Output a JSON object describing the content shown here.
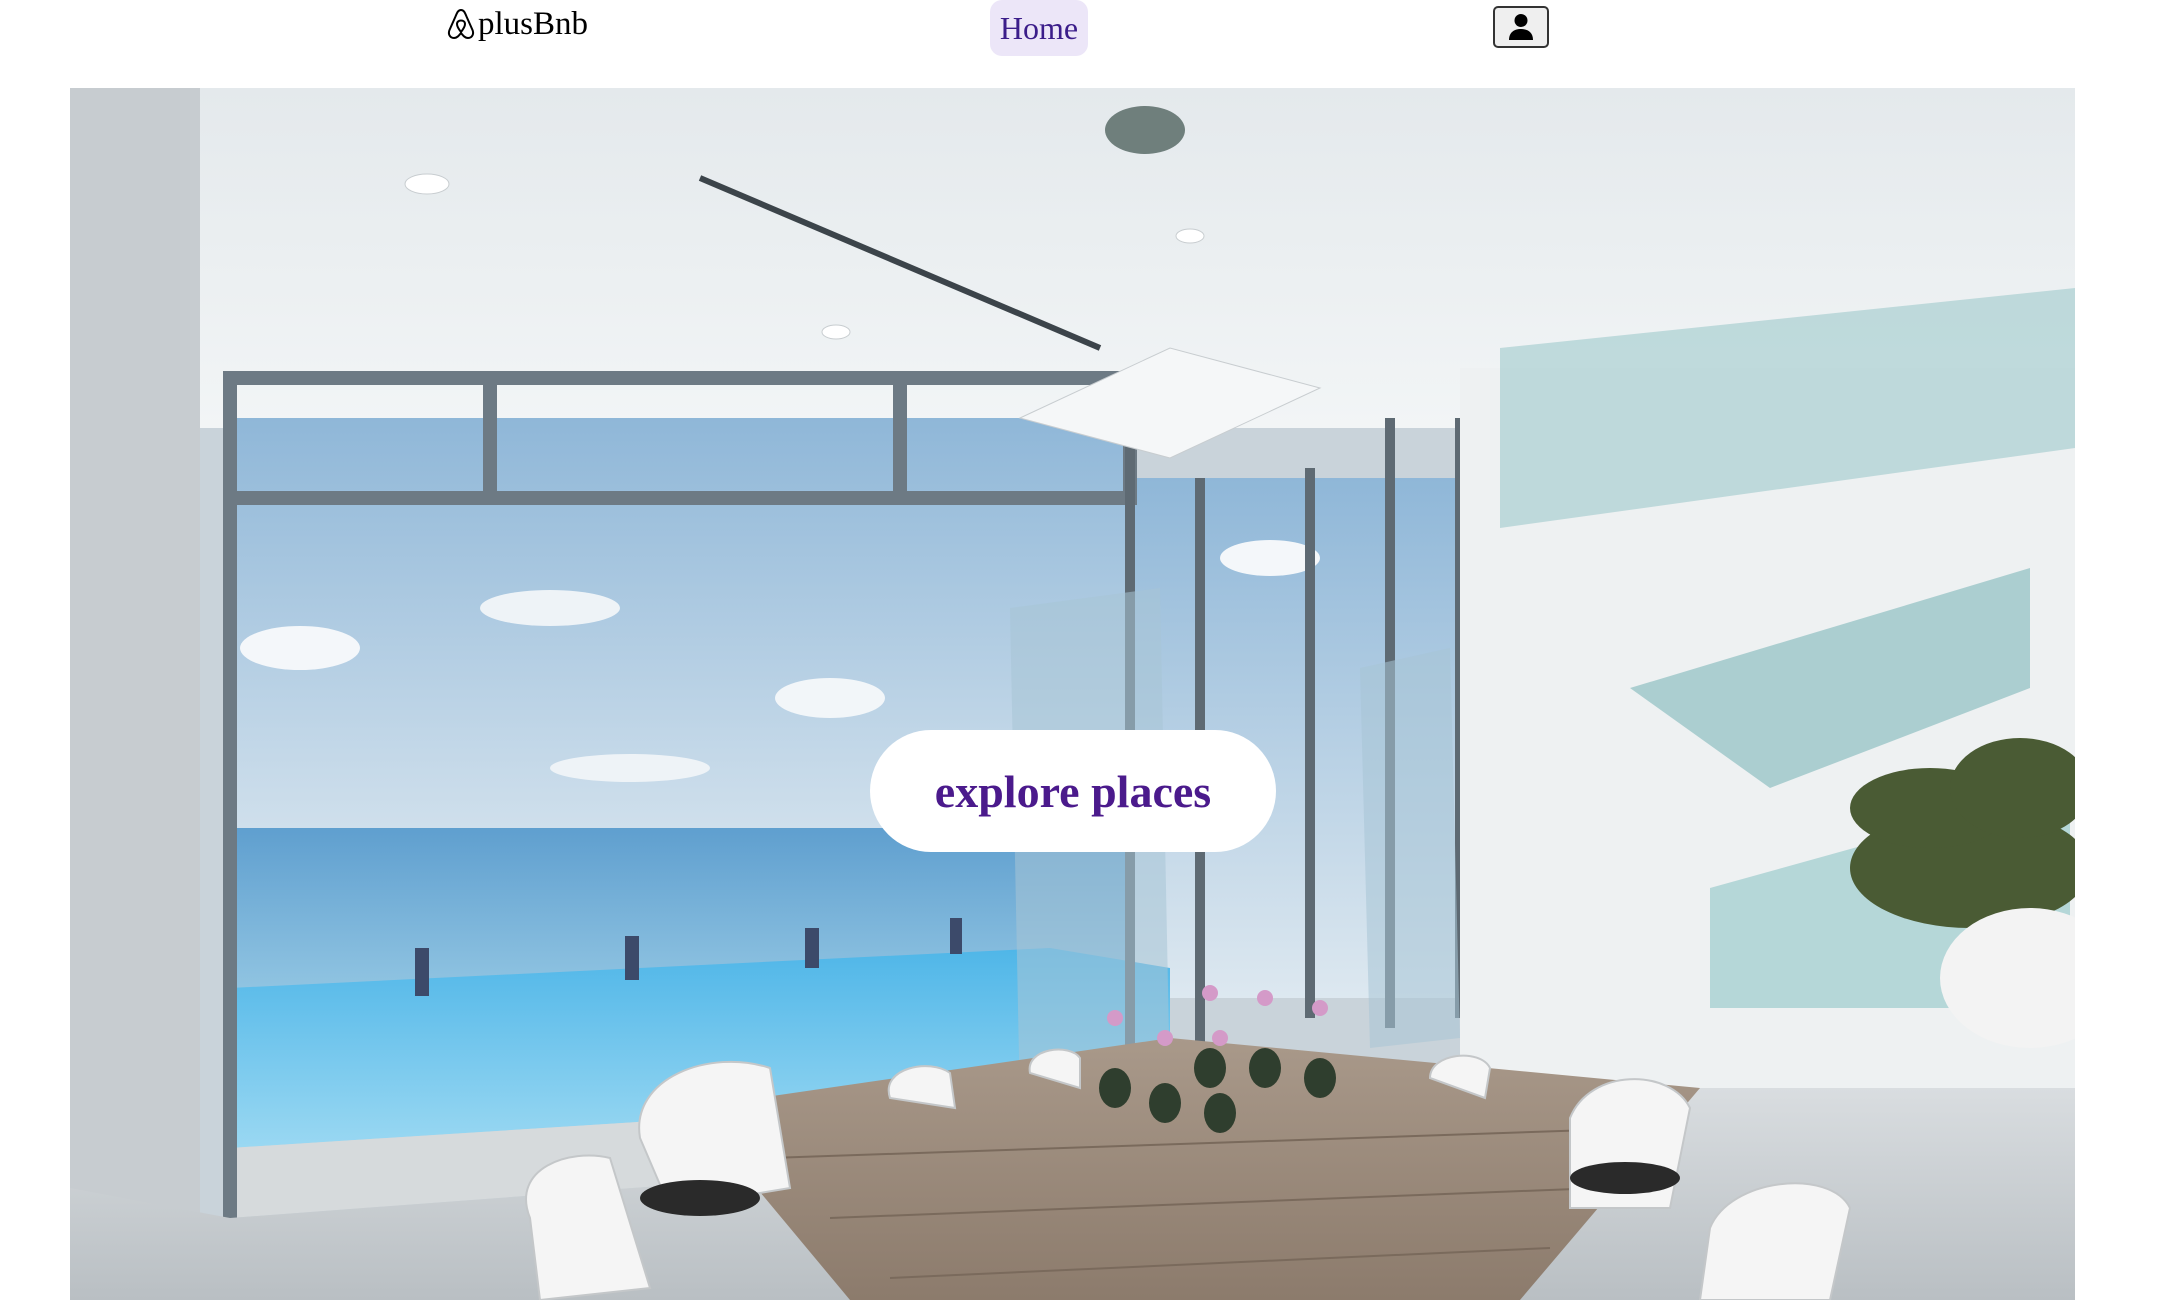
{
  "nav": {
    "logo_text": "plusBnb",
    "home_label": "Home",
    "user_icon": "user-icon"
  },
  "hero": {
    "image_description_icon": "hero-photo",
    "cta_label": "explore places"
  },
  "colors": {
    "accent": "#4b1a8c",
    "home_bg": "#ece6f8",
    "home_text": "#3b1d8a"
  }
}
